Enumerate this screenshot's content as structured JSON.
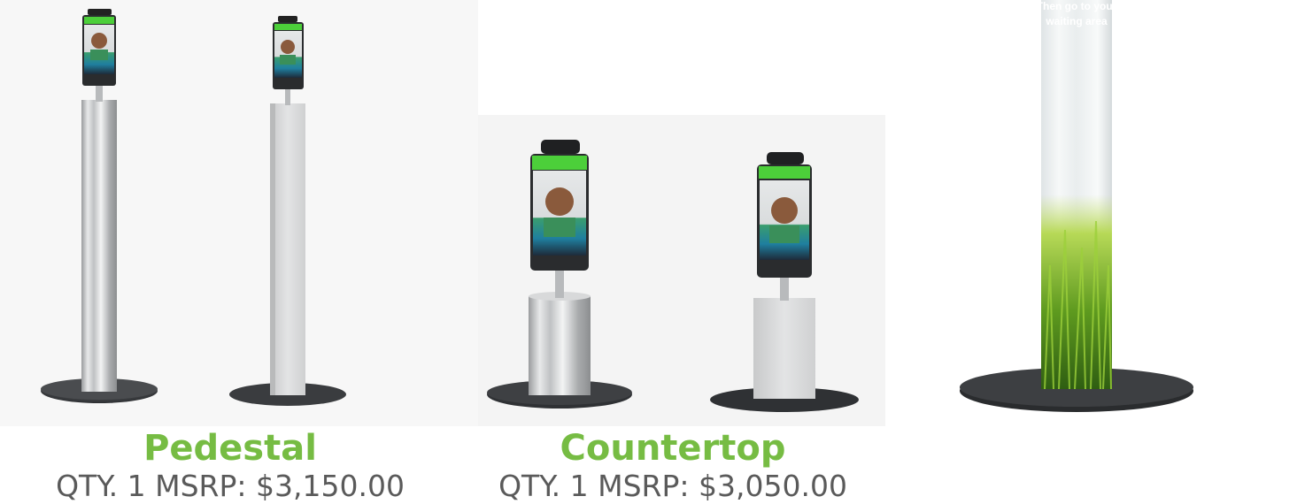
{
  "products": [
    {
      "title": "Pedestal",
      "price": "QTY. 1 MSRP: $3,150.00"
    },
    {
      "title": "Countertop",
      "price": "QTY. 1 MSRP: $3,050.00"
    }
  ],
  "tube_sign": {
    "line1": "Then go to your",
    "line2": "waiting area"
  },
  "colors": {
    "accent_green": "#76bc43",
    "price_gray": "#5a5a5a"
  }
}
